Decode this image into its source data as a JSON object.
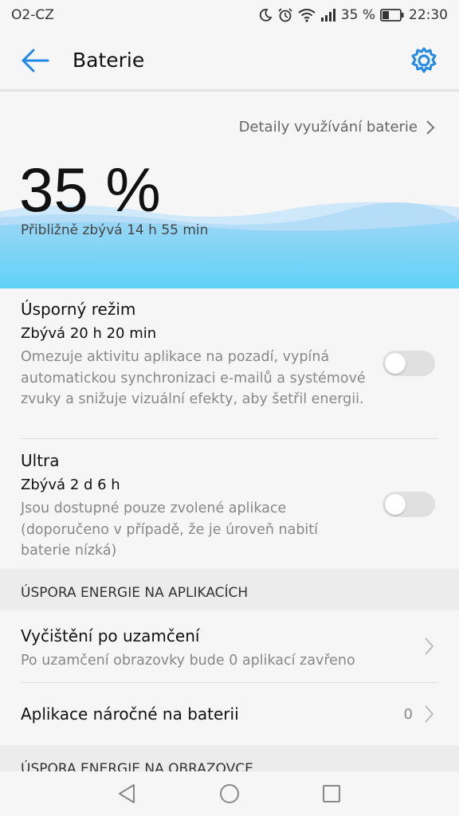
{
  "status": {
    "carrier": "O2-CZ",
    "battery": "35 %",
    "time": "22:30"
  },
  "appbar": {
    "title": "Baterie",
    "back_icon": "back-arrow-icon",
    "settings_icon": "gear-icon"
  },
  "hero": {
    "details_link": "Detaily využívání baterie",
    "percent": "35 %",
    "remaining": "Přibližně zbývá 14 h 55 min",
    "wave_color": "#5fcff3"
  },
  "power_saving": {
    "title": "Úsporný režim",
    "remaining": "Zbývá 20 h 20 min",
    "description": "Omezuje aktivitu aplikace na pozadí, vypíná automatickou synchronizaci e-mailů a systémové zvuky a snižuje vizuální efekty, aby šetřil energii.",
    "enabled": false
  },
  "ultra": {
    "title": "Ultra",
    "remaining": "Zbývá 2 d 6 h",
    "description": "Jsou dostupné pouze zvolené aplikace (doporučeno v případě, že je úroveň nabití baterie nízká)",
    "enabled": false
  },
  "section_apps": {
    "header": "ÚSPORA ENERGIE NA APLIKACÍCH"
  },
  "lock_cleanup": {
    "title": "Vyčištění po uzamčení",
    "subtitle": "Po uzamčení obrazovky bude 0 aplikací zavřeno"
  },
  "heavy_apps": {
    "title": "Aplikace náročné na baterii",
    "count": "0"
  },
  "section_screen": {
    "header": "ÚSPORA ENERGIE NA OBRAZOVCE"
  },
  "navbar": {
    "back_icon": "nav-back-icon",
    "home_icon": "nav-home-icon",
    "recents_icon": "nav-recents-icon"
  }
}
